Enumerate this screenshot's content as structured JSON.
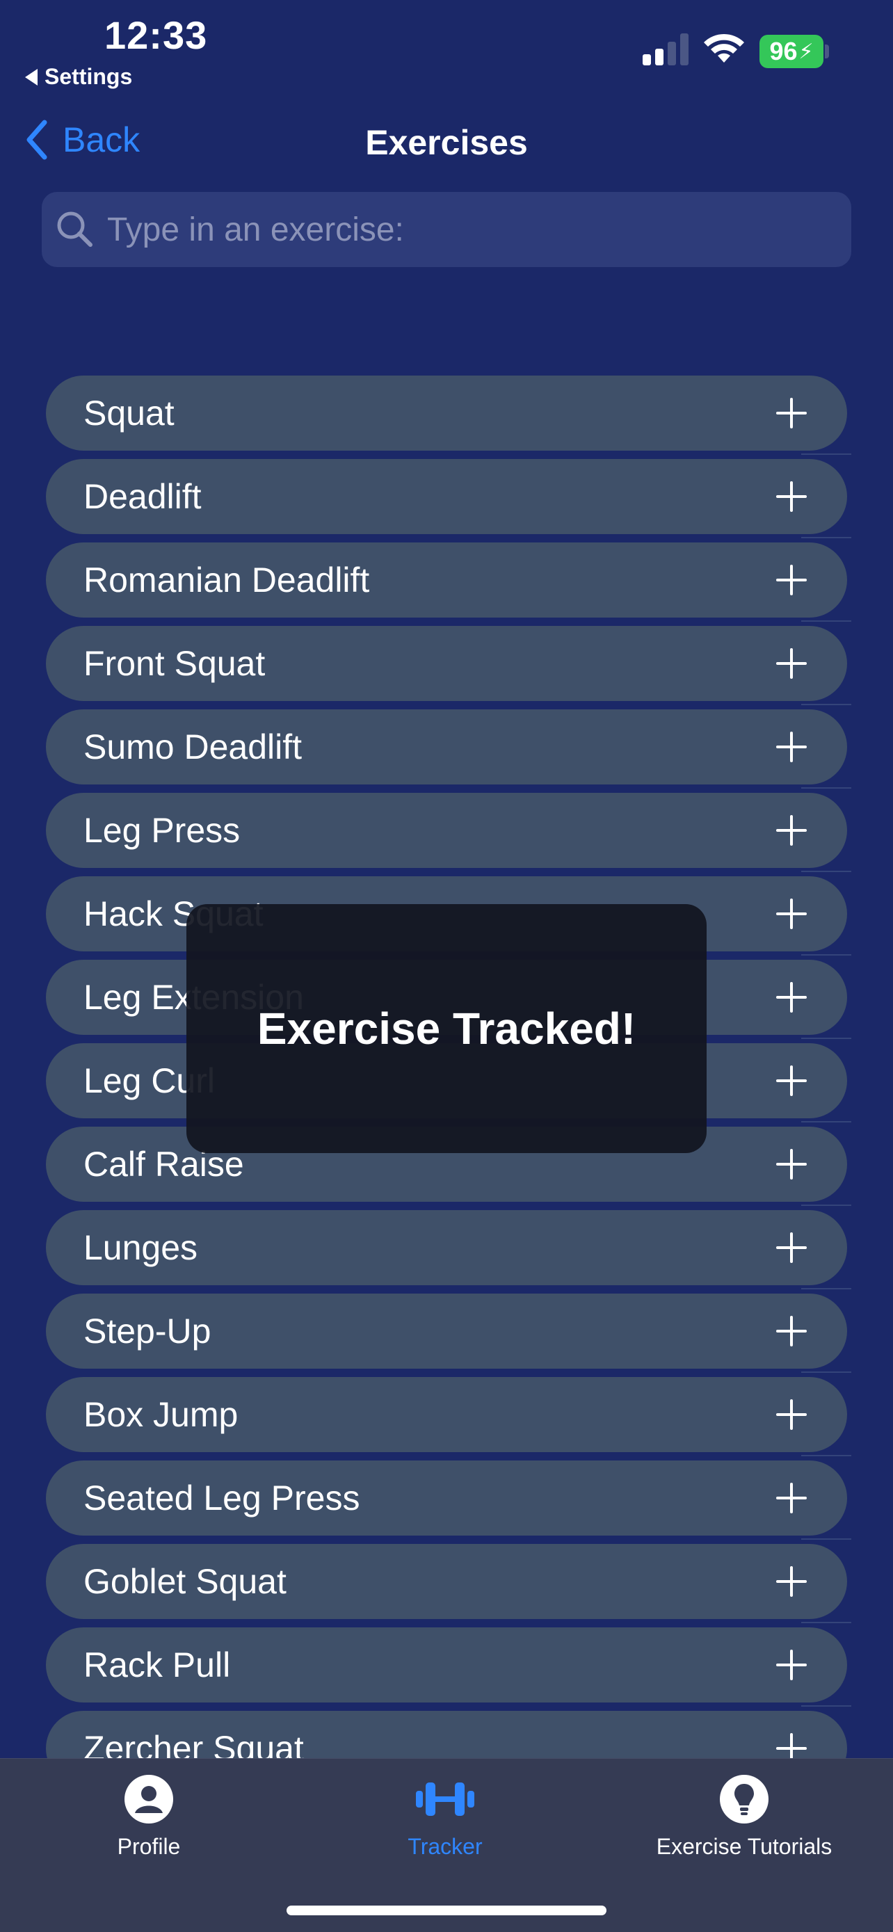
{
  "status_bar": {
    "time": "12:33",
    "back_app": "Settings",
    "battery": "96"
  },
  "nav": {
    "back_label": "Back",
    "title": "Exercises"
  },
  "search": {
    "placeholder": "Type in an exercise:",
    "value": ""
  },
  "exercises": [
    "Squat",
    "Deadlift",
    "Romanian Deadlift",
    "Front Squat",
    "Sumo Deadlift",
    "Leg Press",
    "Hack Squat",
    "Leg Extension",
    "Leg Curl",
    "Calf Raise",
    "Lunges",
    "Step-Up",
    "Box Jump",
    "Seated Leg Press",
    "Goblet Squat",
    "Rack Pull",
    "Zercher Squat"
  ],
  "toast": {
    "message": "Exercise Tracked!"
  },
  "tabbar": {
    "active": "tracker",
    "profile_label": "Profile",
    "tracker_label": "Tracker",
    "tutorials_label": "Exercise Tutorials"
  },
  "colors": {
    "background": "#1b2868",
    "row": "#3f5069",
    "accent": "#2f86ff",
    "battery": "#34c759"
  },
  "icons": {
    "search": "magnifying-glass-icon",
    "add": "plus-icon",
    "profile": "person-circle-icon",
    "tracker": "dumbbell-icon",
    "tutorials": "lightbulb-icon"
  }
}
